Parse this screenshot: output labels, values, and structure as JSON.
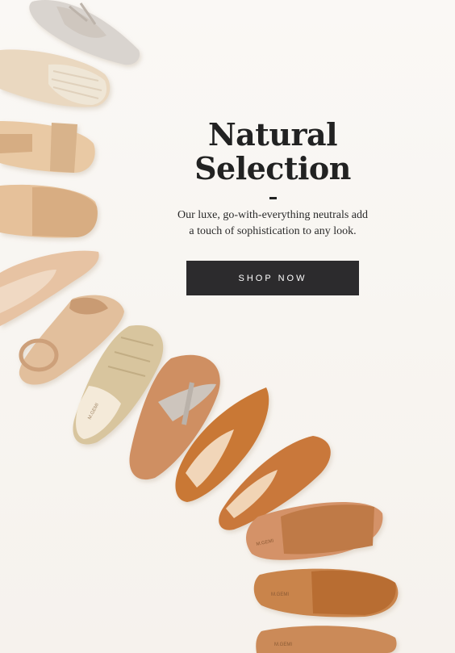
{
  "hero": {
    "title_line1": "Natural",
    "title_line2": "Selection",
    "subtitle_line1": "Our luxe, go-with-everything neutrals add",
    "subtitle_line2": "a touch of sophistication to any look.",
    "cta_label": "SHOP NOW"
  },
  "brand_mark": "M.GEMI",
  "colors": {
    "background": "#f8f5f1",
    "title_text": "#222222",
    "button_bg": "#2c2b2d",
    "button_text": "#ffffff"
  }
}
